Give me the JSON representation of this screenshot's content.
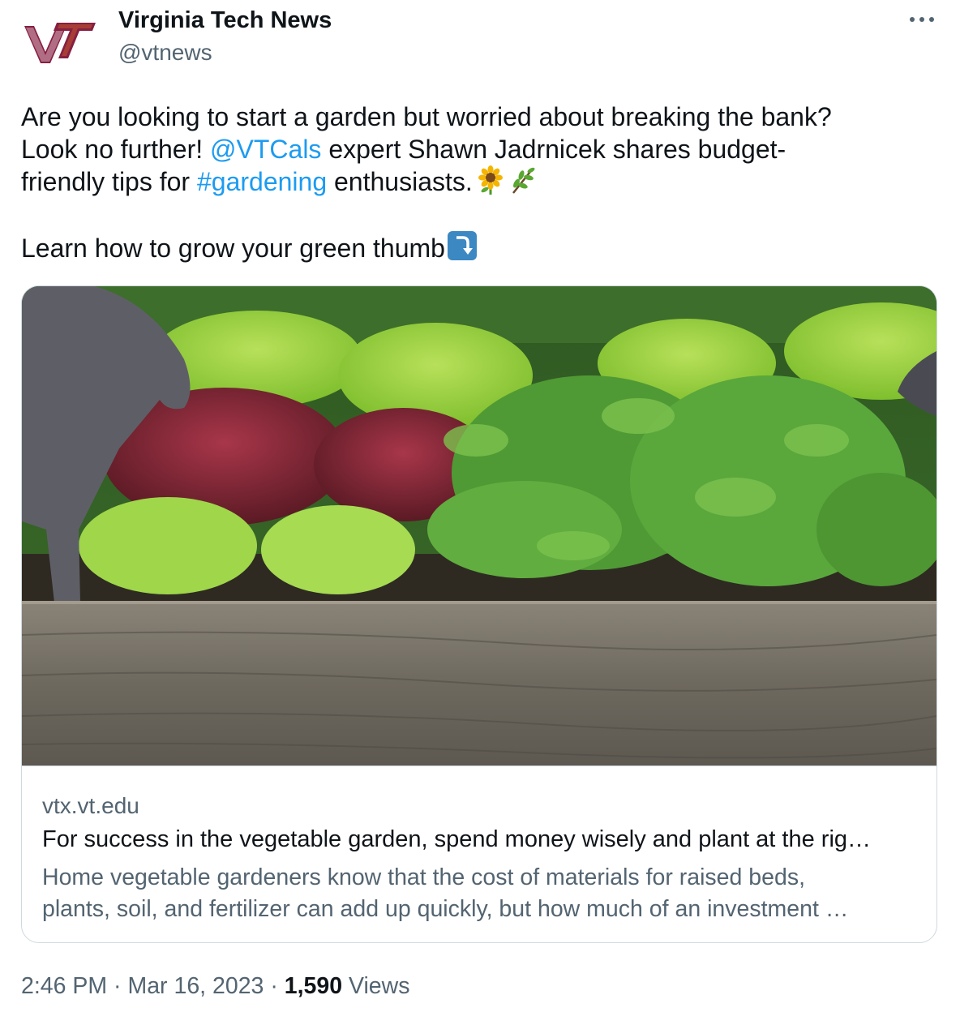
{
  "author": {
    "name": "Virginia Tech News",
    "handle": "@vtnews",
    "avatar_icon": "virginia-tech-logo-icon",
    "brand_color": "#861f41"
  },
  "more_icon": "more-options-icon",
  "tweet": {
    "line1": "Are you looking to start a garden but worried about breaking the bank?",
    "line2_pre": "Look no further! ",
    "mention": "@VTCals",
    "line2_post": " expert  Shawn Jadrnicek shares budget-",
    "line3_pre": "friendly tips for ",
    "hashtag": "#gardening",
    "line3_post": " enthusiasts.",
    "emoji_1": "sunflower-icon",
    "emoji_2": "herb-icon",
    "line5": "Learn how to grow your green thumb",
    "emoji_3": "arrow-down-curve-icon"
  },
  "card": {
    "image": "raised-garden-bed-photo",
    "domain": "vtx.vt.edu",
    "title": "For success in the vegetable garden, spend money wisely and plant at the rig…",
    "desc_line1": "Home vegetable gardeners know that the cost of materials for raised beds,",
    "desc_line2": "plants, soil, and fertilizer can add up quickly, but how much of an investment …"
  },
  "meta": {
    "time": "2:46 PM · Mar 16, 2023 · ",
    "views_count": "1,590",
    "views_label": " Views"
  },
  "colors": {
    "link": "#1d9bf0",
    "text": "#0f1419",
    "secondary": "#536471",
    "border": "#cfd9de",
    "emoji_badge": "#3b88c3"
  }
}
